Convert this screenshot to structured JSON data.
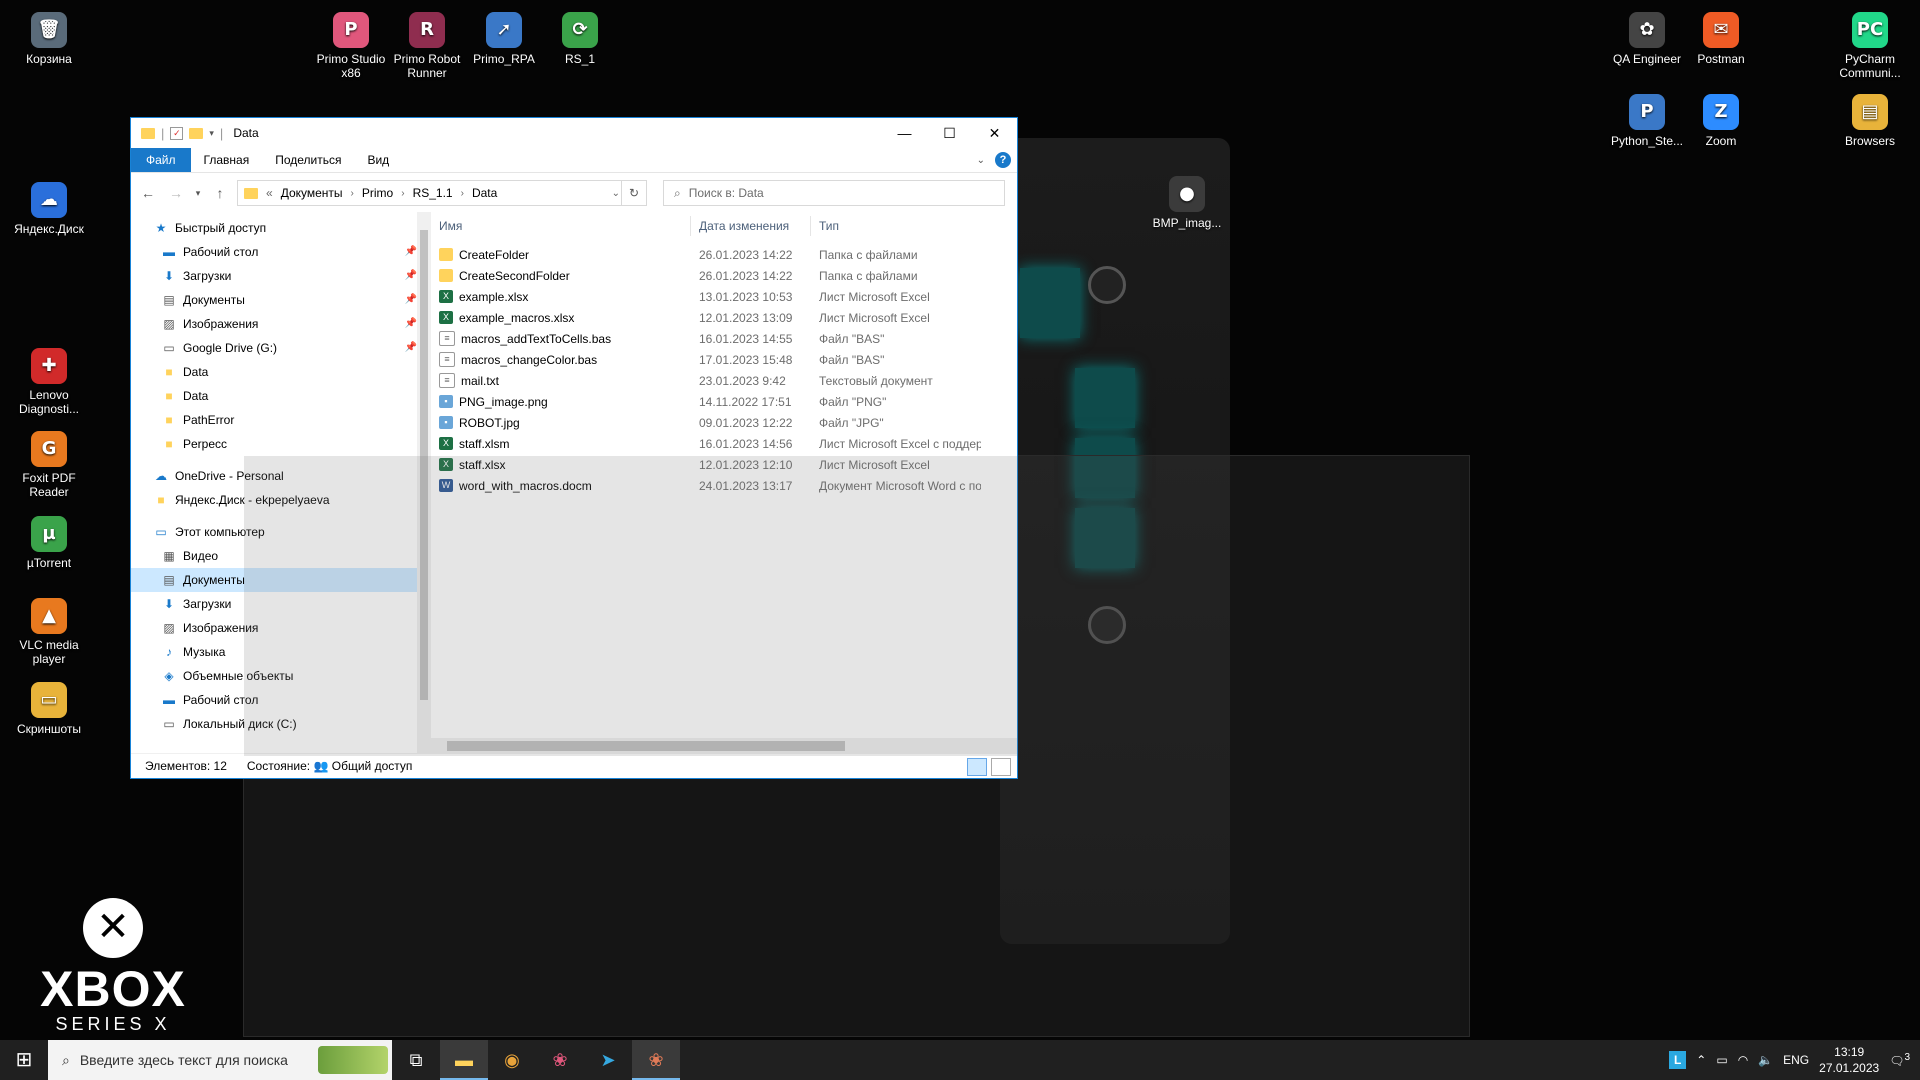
{
  "desktop": {
    "icons": [
      {
        "label": "Корзина",
        "glyph": "🗑",
        "color": "#5a6b7a"
      },
      {
        "label": "Primo Studio x86",
        "glyph": "P",
        "color": "#e0577c"
      },
      {
        "label": "Primo Robot Runner",
        "glyph": "R",
        "color": "#8f2d4f"
      },
      {
        "label": "Primo_RPA",
        "glyph": "➚",
        "color": "#3a78c7"
      },
      {
        "label": "RS_1",
        "glyph": "⟳",
        "color": "#3aa34a"
      },
      {
        "label": "Яндекс.Диск",
        "glyph": "☁",
        "color": "#2a6fdb"
      },
      {
        "label": "Lenovo Diagnosti...",
        "glyph": "✚",
        "color": "#d12a2a"
      },
      {
        "label": "Foxit PDF Reader",
        "glyph": "G",
        "color": "#e8791f"
      },
      {
        "label": "µTorrent",
        "glyph": "µ",
        "color": "#3aa34a"
      },
      {
        "label": "VLC media player",
        "glyph": "▲",
        "color": "#e8791f"
      },
      {
        "label": "Скриншоты",
        "glyph": "▭",
        "color": "#e8b33a"
      },
      {
        "label": "QA Engineer",
        "glyph": "✿",
        "color": "#444"
      },
      {
        "label": "Postman",
        "glyph": "✉",
        "color": "#ef5b25"
      },
      {
        "label": "PyCharm Communi...",
        "glyph": "PC",
        "color": "#21d789"
      },
      {
        "label": "Python_Ste...",
        "glyph": "P",
        "color": "#3a78c7"
      },
      {
        "label": "Zoom",
        "glyph": "Z",
        "color": "#2d8cff"
      },
      {
        "label": "Browsers",
        "glyph": "▤",
        "color": "#e8b33a"
      },
      {
        "label": "BMP_imag...",
        "glyph": "●",
        "color": "#3b3b3b"
      }
    ],
    "xbox": {
      "word": "XBOX",
      "sub": "SERIES X"
    }
  },
  "explorer": {
    "title": "Data",
    "window_controls": {
      "minimize": "—",
      "maximize": "☐",
      "close": "✕"
    },
    "ribbon_tabs": [
      "Файл",
      "Главная",
      "Поделиться",
      "Вид"
    ],
    "breadcrumb": [
      "Документы",
      "Primo",
      "RS_1.1",
      "Data"
    ],
    "breadcrumb_prefix": "«",
    "search_placeholder": "Поиск в: Data",
    "nav": [
      {
        "label": "Быстрый доступ",
        "icon": "★",
        "color": "#1979ca",
        "indent": 0,
        "pin": false
      },
      {
        "label": "Рабочий стол",
        "icon": "▬",
        "color": "#1979ca",
        "indent": 1,
        "pin": true
      },
      {
        "label": "Загрузки",
        "icon": "⬇",
        "color": "#1979ca",
        "indent": 1,
        "pin": true
      },
      {
        "label": "Документы",
        "icon": "▤",
        "color": "#555",
        "indent": 1,
        "pin": true
      },
      {
        "label": "Изображения",
        "icon": "▨",
        "color": "#555",
        "indent": 1,
        "pin": true
      },
      {
        "label": "Google Drive (G:)",
        "icon": "▭",
        "color": "#555",
        "indent": 1,
        "pin": true
      },
      {
        "label": "Data",
        "icon": "■",
        "color": "#ffd35c",
        "indent": 1,
        "pin": false
      },
      {
        "label": "Data",
        "icon": "■",
        "color": "#ffd35c",
        "indent": 1,
        "pin": false
      },
      {
        "label": "PathError",
        "icon": "■",
        "color": "#ffd35c",
        "indent": 1,
        "pin": false
      },
      {
        "label": "Perpecc",
        "icon": "■",
        "color": "#ffd35c",
        "indent": 1,
        "pin": false
      },
      {
        "label": "OneDrive - Personal",
        "icon": "☁",
        "color": "#1979ca",
        "indent": 0,
        "pin": false
      },
      {
        "label": "Яндекс.Диск - ekpepelyaeva",
        "icon": "■",
        "color": "#ffd35c",
        "indent": 0,
        "pin": false
      },
      {
        "label": "Этот компьютер",
        "icon": "▭",
        "color": "#1979ca",
        "indent": 0,
        "pin": false
      },
      {
        "label": "Видео",
        "icon": "▦",
        "color": "#555",
        "indent": 1,
        "pin": false
      },
      {
        "label": "Документы",
        "icon": "▤",
        "color": "#555",
        "indent": 1,
        "pin": false
      },
      {
        "label": "Загрузки",
        "icon": "⬇",
        "color": "#1979ca",
        "indent": 1,
        "pin": false
      },
      {
        "label": "Изображения",
        "icon": "▨",
        "color": "#555",
        "indent": 1,
        "pin": false
      },
      {
        "label": "Музыка",
        "icon": "♪",
        "color": "#1979ca",
        "indent": 1,
        "pin": false
      },
      {
        "label": "Объемные объекты",
        "icon": "◈",
        "color": "#1979ca",
        "indent": 1,
        "pin": false
      },
      {
        "label": "Рабочий стол",
        "icon": "▬",
        "color": "#1979ca",
        "indent": 1,
        "pin": false
      },
      {
        "label": "Локальный диск (C:)",
        "icon": "▭",
        "color": "#555",
        "indent": 1,
        "pin": false
      }
    ],
    "nav_selected": "Документы",
    "columns": {
      "name": "Имя",
      "date": "Дата изменения",
      "type": "Тип"
    },
    "files": [
      {
        "name": "CreateFolder",
        "date": "26.01.2023 14:22",
        "type": "Папка с файлами",
        "kind": "folder"
      },
      {
        "name": "CreateSecondFolder",
        "date": "26.01.2023 14:22",
        "type": "Папка с файлами",
        "kind": "folder"
      },
      {
        "name": "example.xlsx",
        "date": "13.01.2023 10:53",
        "type": "Лист Microsoft Excel",
        "kind": "excel"
      },
      {
        "name": "example_macros.xlsx",
        "date": "12.01.2023 13:09",
        "type": "Лист Microsoft Excel",
        "kind": "excel"
      },
      {
        "name": "macros_addTextToCells.bas",
        "date": "16.01.2023 14:55",
        "type": "Файл \"BAS\"",
        "kind": "doc"
      },
      {
        "name": "macros_changeColor.bas",
        "date": "17.01.2023 15:48",
        "type": "Файл \"BAS\"",
        "kind": "doc"
      },
      {
        "name": "mail.txt",
        "date": "23.01.2023 9:42",
        "type": "Текстовый документ",
        "kind": "doc"
      },
      {
        "name": "PNG_image.png",
        "date": "14.11.2022 17:51",
        "type": "Файл \"PNG\"",
        "kind": "img"
      },
      {
        "name": "ROBOT.jpg",
        "date": "09.01.2023 12:22",
        "type": "Файл \"JPG\"",
        "kind": "img"
      },
      {
        "name": "staff.xlsm",
        "date": "16.01.2023 14:56",
        "type": "Лист Microsoft Excel с поддерж",
        "kind": "excel"
      },
      {
        "name": "staff.xlsx",
        "date": "12.01.2023 12:10",
        "type": "Лист Microsoft Excel",
        "kind": "excel"
      },
      {
        "name": "word_with_macros.docm",
        "date": "24.01.2023 13:17",
        "type": "Документ Microsoft Word с по",
        "kind": "word"
      }
    ],
    "status": {
      "count": "Элементов: 12",
      "state": "Состояние:",
      "share": "Общий доступ"
    }
  },
  "taskbar": {
    "search_placeholder": "Введите здесь текст для поиска",
    "lang": "ENG",
    "time": "13:19",
    "date": "27.01.2023",
    "notifications": "3"
  }
}
